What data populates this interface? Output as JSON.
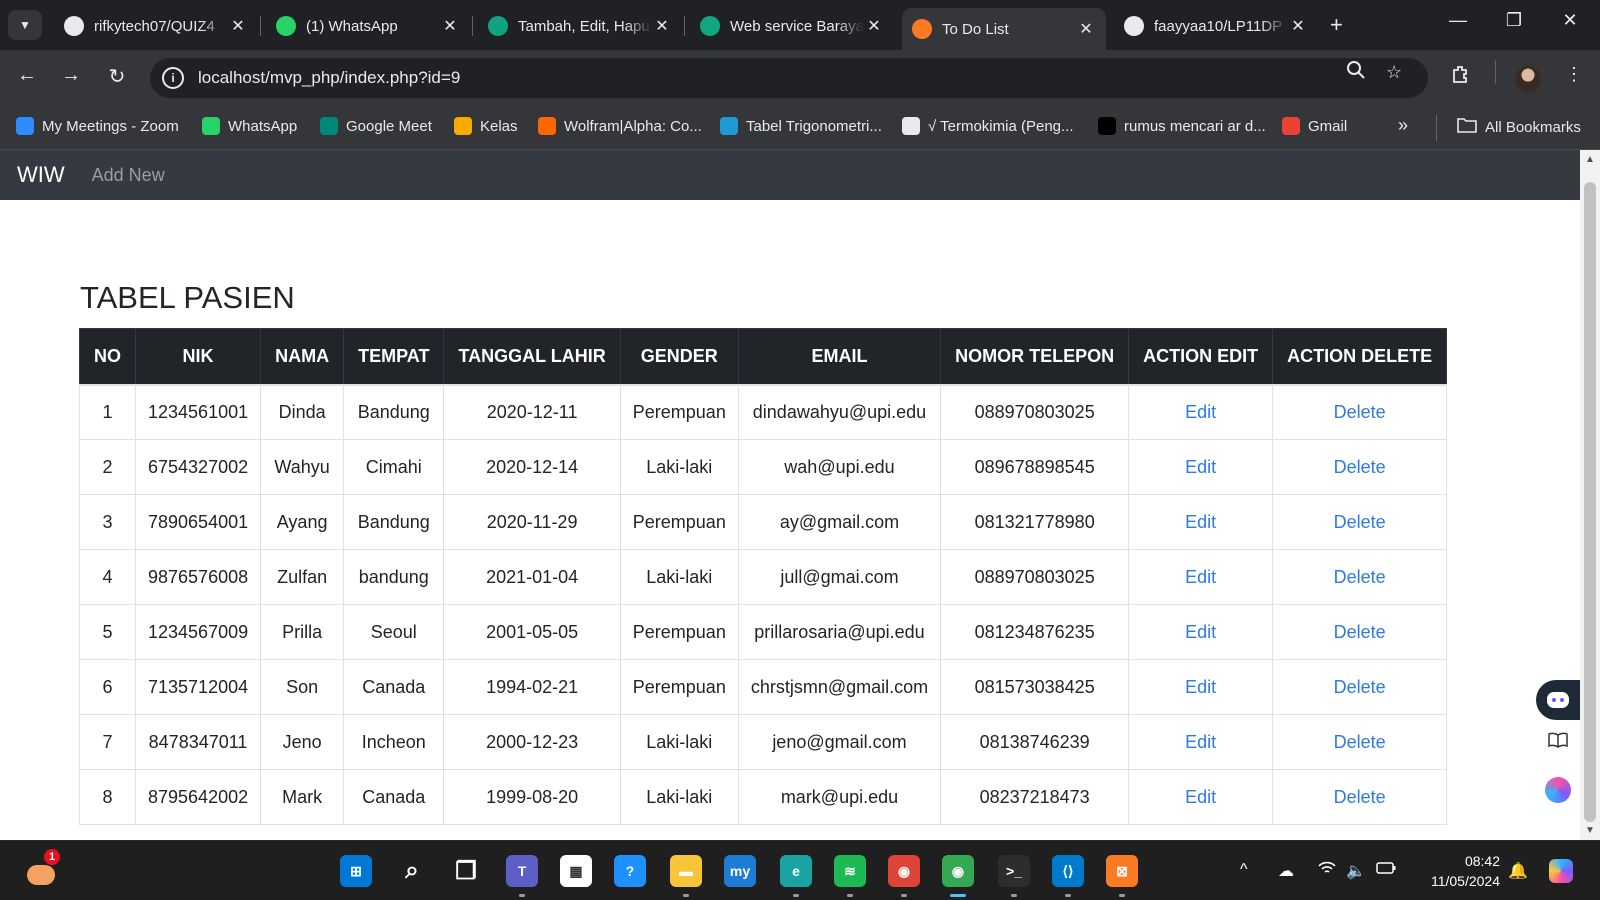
{
  "browser": {
    "tabs": [
      {
        "title": "rifkytech07/QUIZ4",
        "icon": "github-icon",
        "active": false
      },
      {
        "title": "(1) WhatsApp",
        "icon": "whatsapp-icon",
        "active": false
      },
      {
        "title": "Tambah, Edit, Hapus",
        "icon": "chatgpt-icon",
        "active": false
      },
      {
        "title": "Web service Barayat",
        "icon": "feather-icon",
        "active": false
      },
      {
        "title": "To Do List",
        "icon": "xampp-icon",
        "active": true
      },
      {
        "title": "faayyaa10/LP11DP",
        "icon": "github-icon",
        "active": false
      }
    ],
    "url": "localhost/mvp_php/index.php?id=9",
    "bookmarks": [
      {
        "label": "My Meetings - Zoom",
        "icon": "zoom-icon",
        "color": "#2d8cff"
      },
      {
        "label": "WhatsApp",
        "icon": "whatsapp-icon",
        "color": "#25d366"
      },
      {
        "label": "Google Meet",
        "icon": "google-meet-icon",
        "color": "#00897b"
      },
      {
        "label": "Kelas",
        "icon": "classroom-icon",
        "color": "#f9ab00"
      },
      {
        "label": "Wolfram|Alpha: Co...",
        "icon": "wolfram-icon",
        "color": "#ff6600"
      },
      {
        "label": "Tabel Trigonometri...",
        "icon": "s-icon",
        "color": "#1e9bd7"
      },
      {
        "label": "√ Termokimia (Peng...",
        "icon": "book-icon",
        "color": "#e8eaed"
      },
      {
        "label": "rumus mencari ar d...",
        "icon": "b-icon",
        "color": "#000000"
      },
      {
        "label": "Gmail",
        "icon": "gmail-icon",
        "color": "#ea4335"
      }
    ],
    "all_bookmarks_label": "All Bookmarks",
    "overflow_label": "»"
  },
  "page": {
    "brand": "WIW",
    "nav_add_new": "Add New",
    "title": "TABEL PASIEN",
    "table": {
      "headers": [
        "NO",
        "NIK",
        "NAMA",
        "TEMPAT",
        "TANGGAL LAHIR",
        "GENDER",
        "EMAIL",
        "NOMOR TELEPON",
        "ACTION EDIT",
        "ACTION DELETE"
      ],
      "edit_label": "Edit",
      "delete_label": "Delete",
      "rows": [
        [
          "1",
          "1234561001",
          "Dinda",
          "Bandung",
          "2020-12-11",
          "Perempuan",
          "dindawahyu@upi.edu",
          "088970803025"
        ],
        [
          "2",
          "6754327002",
          "Wahyu",
          "Cimahi",
          "2020-12-14",
          "Laki-laki",
          "wah@upi.edu",
          "089678898545"
        ],
        [
          "3",
          "7890654001",
          "Ayang",
          "Bandung",
          "2020-11-29",
          "Perempuan",
          "ay@gmail.com",
          "081321778980"
        ],
        [
          "4",
          "9876576008",
          "Zulfan",
          "bandung",
          "2021-01-04",
          "Laki-laki",
          "jull@gmai.com",
          "088970803025"
        ],
        [
          "5",
          "1234567009",
          "Prilla",
          "Seoul",
          "2001-05-05",
          "Perempuan",
          "prillarosaria@upi.edu",
          "081234876235"
        ],
        [
          "6",
          "7135712004",
          "Son",
          "Canada",
          "1994-02-21",
          "Perempuan",
          "chrstjsmn@gmail.com",
          "081573038425"
        ],
        [
          "7",
          "8478347011",
          "Jeno",
          "Incheon",
          "2000-12-23",
          "Laki-laki",
          "jeno@gmail.com",
          "08138746239"
        ],
        [
          "8",
          "8795642002",
          "Mark",
          "Canada",
          "1999-08-20",
          "Laki-laki",
          "mark@upi.edu",
          "08237218473"
        ]
      ]
    }
  },
  "taskbar": {
    "weather_badge": "1",
    "time": "08:42",
    "date": "11/05/2024",
    "apps": [
      {
        "name": "start-icon",
        "color": "#0078d4"
      },
      {
        "name": "search-icon",
        "color": "transparent"
      },
      {
        "name": "task-view-icon",
        "color": "transparent"
      },
      {
        "name": "teams-icon",
        "color": "#5b5fc7"
      },
      {
        "name": "store-icon",
        "color": "#ffffff"
      },
      {
        "name": "tips-icon",
        "color": "#1e90ff"
      },
      {
        "name": "file-explorer-icon",
        "color": "#f8c43a"
      },
      {
        "name": "mylab-icon",
        "color": "#1e7cd6"
      },
      {
        "name": "edge-icon",
        "color": "#1aa3a3"
      },
      {
        "name": "spotify-icon",
        "color": "#1db954"
      },
      {
        "name": "chrome-profile-icon",
        "color": "#db4437"
      },
      {
        "name": "chrome-icon",
        "color": "#34a853"
      },
      {
        "name": "terminal-icon",
        "color": "#2d2d2d"
      },
      {
        "name": "vscode-icon",
        "color": "#007acc"
      },
      {
        "name": "xampp-icon",
        "color": "#fb7a24"
      }
    ]
  }
}
